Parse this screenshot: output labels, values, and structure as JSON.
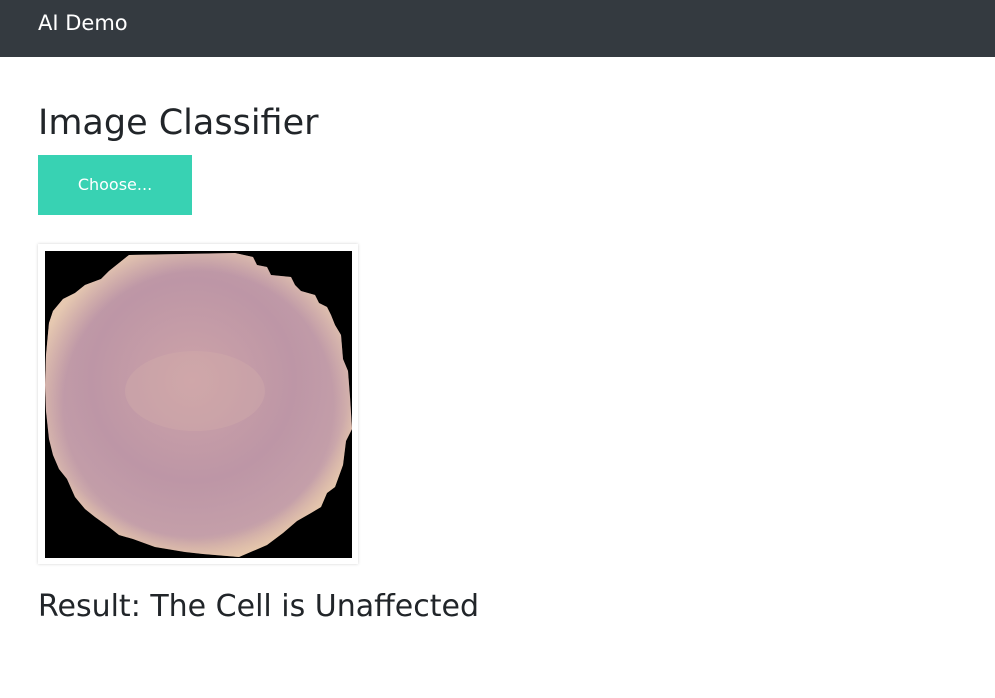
{
  "navbar": {
    "brand": "AI Demo"
  },
  "main": {
    "title": "Image Classifier",
    "choose_label": "Choose...",
    "result_text": "Result: The Cell is Unaffected"
  },
  "colors": {
    "navbar_bg": "#343a40",
    "accent": "#38d2b3",
    "cell_fill": "#bf98a6",
    "cell_rim": "#e3c3a8"
  },
  "icons": {
    "preview": "blood-cell-image"
  }
}
